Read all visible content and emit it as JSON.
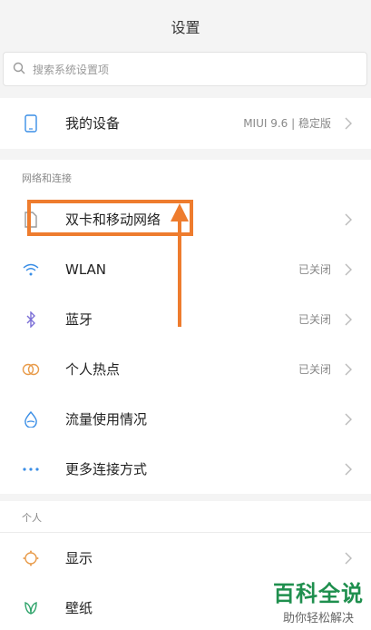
{
  "header": {
    "title": "设置"
  },
  "search": {
    "placeholder": "搜索系统设置项"
  },
  "device": {
    "label": "我的设备",
    "value": "MIUI 9.6 | 稳定版"
  },
  "network": {
    "section_title": "网络和连接",
    "items": [
      {
        "label": "双卡和移动网络",
        "value": "",
        "icon": "sim-card-icon"
      },
      {
        "label": "WLAN",
        "value": "已关闭",
        "icon": "wifi-icon"
      },
      {
        "label": "蓝牙",
        "value": "已关闭",
        "icon": "bluetooth-icon"
      },
      {
        "label": "个人热点",
        "value": "已关闭",
        "icon": "hotspot-icon"
      },
      {
        "label": "流量使用情况",
        "value": "",
        "icon": "data-usage-icon"
      },
      {
        "label": "更多连接方式",
        "value": "",
        "icon": "more-icon"
      }
    ]
  },
  "personal": {
    "section_title": "个人",
    "items": [
      {
        "label": "显示",
        "icon": "display-icon"
      },
      {
        "label": "壁纸",
        "icon": "wallpaper-icon"
      }
    ]
  },
  "watermark": {
    "main": "百科全说",
    "sub": "助你轻松解决"
  },
  "colors": {
    "accent": "#ee7c2e",
    "blue_icon": "#3a8ee6",
    "watermark": "#1f8f4e"
  }
}
